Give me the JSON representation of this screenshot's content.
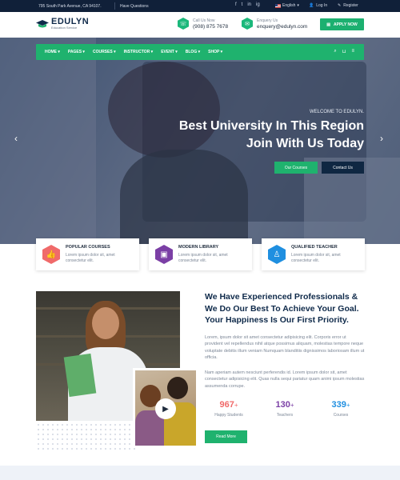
{
  "topbar": {
    "address": "795 South Park Avenue, CA 94107.",
    "questions": "Have Questions",
    "social": [
      "f",
      "t",
      "in",
      "ig"
    ],
    "language": "English",
    "login": "Log In",
    "register": "Register"
  },
  "header": {
    "brand": "EDULYN",
    "tagline": "Education Service",
    "call_label": "Call Us Now",
    "call_value": "(908) 875 7678",
    "enquiry_label": "Enquery Us",
    "enquiry_value": "enquery@edulyn.com",
    "apply_label": "APPLY NOW"
  },
  "nav": {
    "items": [
      "HOME",
      "PAGES",
      "COURSES",
      "INSTRUCTOR",
      "EVENT",
      "BLOG",
      "SHOP"
    ]
  },
  "hero": {
    "kicker": "WELCOME TO EDULYN.",
    "title_line1": "Best University In This Region",
    "title_line2": "Join With Us Today",
    "btn_courses": "Our Courses",
    "btn_contact": "Contact Us"
  },
  "features": [
    {
      "title": "POPULAR COURSES",
      "desc": "Lorem ipsum dolor sit, amet consectetur elit.",
      "color": "#f06a6a"
    },
    {
      "title": "MODERN LIBRARY",
      "desc": "Lorem ipsum dolor sit, amet consectetur elit.",
      "color": "#7b3fa5"
    },
    {
      "title": "QUALIFIED TEACHER",
      "desc": "Lorem ipsum dolor sit, amet consectetur elit.",
      "color": "#1f8fe0"
    }
  ],
  "about": {
    "heading": "We Have Experienced Professionals & We Do Our Best To Achieve Your Goal. Your Happiness Is Our First Priority.",
    "para1": "Lorem, ipsum dolor sit amet consectetur adipisicing elit. Corporis error ut provident vel repellendus nihil atque possimus aliquam, molestias tempore neque voluptate debitis illum veniam Numquam blanditiis dignissimos laboriosam illum ut officia.",
    "para2": "Nam aperiam autem nesciunt perferendis id. Lorem ipsum dolor sit, amet consectetur adipisicing elit. Quas nulla sequi pariatur quam animi ipsum molestias assumenda corrupe.",
    "read_more": "Read More"
  },
  "stats": [
    {
      "value": "967",
      "plus": "+",
      "label": "Happy Students",
      "color": "#f06a6a"
    },
    {
      "value": "130",
      "plus": "+",
      "label": "Teachers",
      "color": "#7b3fa5"
    },
    {
      "value": "339",
      "plus": "+",
      "label": "Courses",
      "color": "#1f8fe0"
    }
  ]
}
